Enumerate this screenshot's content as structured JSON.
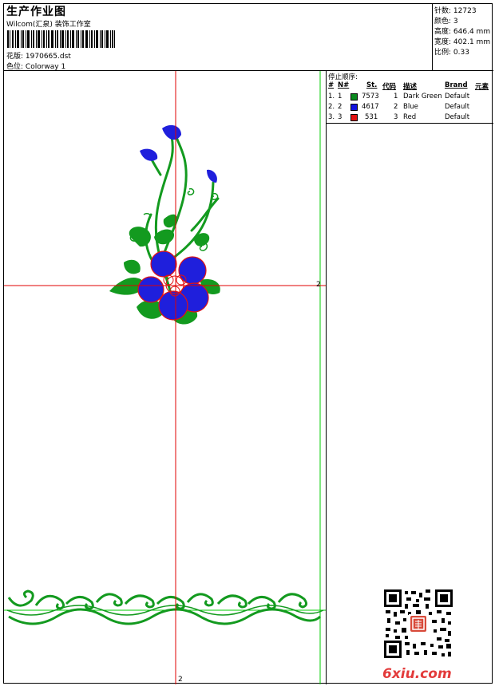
{
  "header": {
    "title": "生产作业图",
    "studio": "Wilcom(汇泉) 装饰工作室",
    "design_label": "花版:",
    "design_value": "1970665.dst",
    "color_label": "色位:",
    "color_value": "Colorway 1"
  },
  "stats": {
    "stitches_label": "针数:",
    "stitches_value": "12723",
    "colors_label": "颜色:",
    "colors_value": "3",
    "height_label": "高度:",
    "height_value": "646.4 mm",
    "width_label": "宽度:",
    "width_value": "402.1 mm",
    "scale_label": "比例:",
    "scale_value": "0.33"
  },
  "panel": {
    "stop_sequence_label": "停止顺序:",
    "columns": [
      "#",
      "N#",
      "St.",
      "代码",
      "描述",
      "Brand",
      "元素"
    ],
    "rows": [
      {
        "idx": "1.",
        "n": "1",
        "color": "#0a8a1e",
        "stitches": "7573",
        "code": "1",
        "desc": "Dark Green",
        "brand": "Default"
      },
      {
        "idx": "2.",
        "n": "2",
        "color": "#1212e0",
        "stitches": "4617",
        "code": "2",
        "desc": "Blue",
        "brand": "Default"
      },
      {
        "idx": "3.",
        "n": "3",
        "color": "#e21212",
        "stitches": "531",
        "code": "3",
        "desc": "Red",
        "brand": "Default"
      }
    ]
  },
  "canvas": {
    "crosshair_label_right": "2",
    "crosshair_label_bottom": "2",
    "guide_color": "#e00000",
    "frame_color": "#00cc00"
  },
  "watermark": {
    "text": "6xiu.com"
  }
}
